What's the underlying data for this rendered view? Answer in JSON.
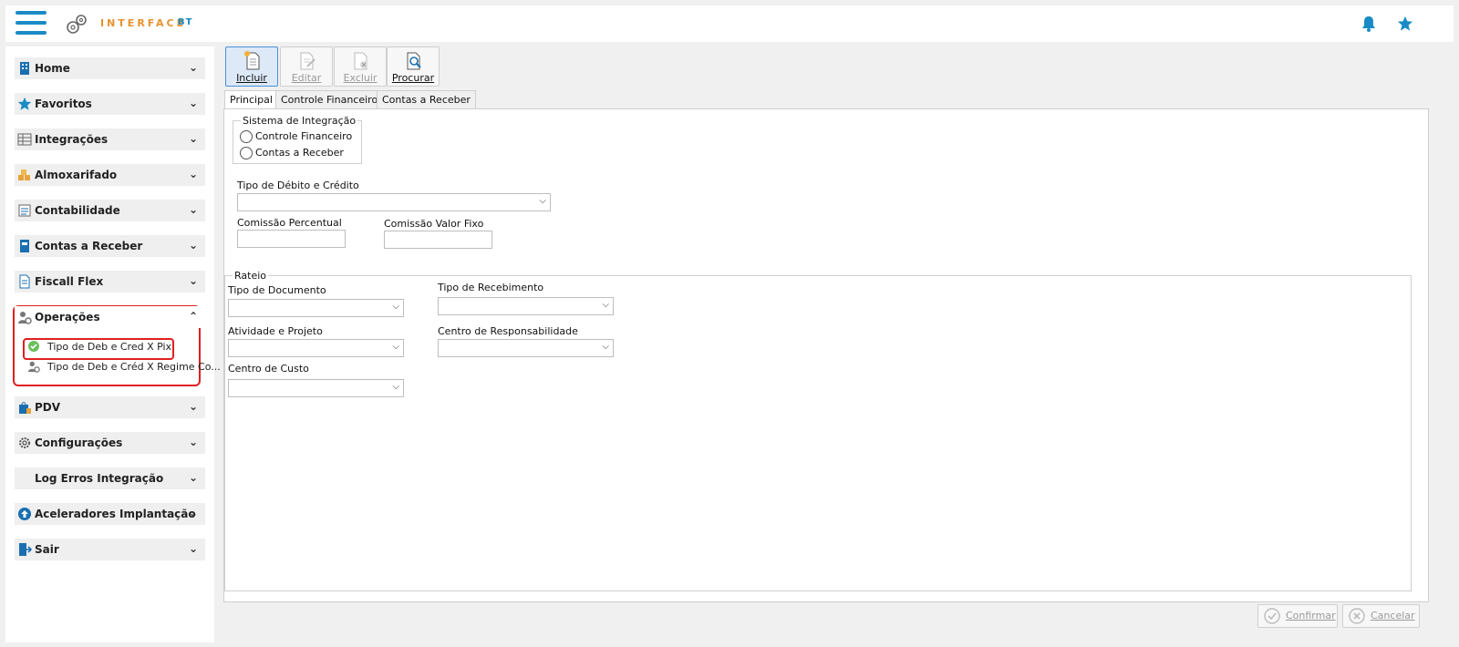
{
  "header": {
    "brand": "INTERFACE",
    "brand_suffix": "BT",
    "icons": [
      "menu-icon",
      "gear-logo-icon",
      "bell-icon",
      "star-icon"
    ],
    "accent": "#1a8bc4",
    "brand_color": "#e8922e"
  },
  "sidebar": {
    "items": [
      {
        "label": "Home",
        "icon": "building-icon"
      },
      {
        "label": "Favoritos",
        "icon": "star-icon"
      },
      {
        "label": "Integrações",
        "icon": "table-icon"
      },
      {
        "label": "Almoxarifado",
        "icon": "boxes-icon"
      },
      {
        "label": "Contabilidade",
        "icon": "ledger-icon"
      },
      {
        "label": "Contas a Receber",
        "icon": "book-icon"
      },
      {
        "label": "Fiscall Flex",
        "icon": "document-icon"
      },
      {
        "label": "Operações",
        "icon": "user-gear-icon"
      },
      {
        "label": "PDV",
        "icon": "bag-icon"
      },
      {
        "label": "Configurações",
        "icon": "gear-icon"
      },
      {
        "label": "Log Erros Integração",
        "icon": "log-icon"
      },
      {
        "label": "Aceleradores Implantação",
        "icon": "arrow-up-icon"
      },
      {
        "label": "Sair",
        "icon": "exit-icon"
      }
    ],
    "sub_items": [
      {
        "label": "Tipo de Deb e Cred X Pix",
        "icon": "check-icon"
      },
      {
        "label": "Tipo de Deb e Créd X Regime Co...",
        "icon": "user-gear-icon"
      }
    ]
  },
  "toolbar": {
    "incluir": "Incluir",
    "editar": "Editar",
    "excluir": "Excluir",
    "procurar": "Procurar"
  },
  "tabs": [
    "Principal",
    "Controle Financeiro",
    "Contas a Receber"
  ],
  "form": {
    "sistema_integracao": {
      "title": "Sistema de Integração",
      "options": [
        "Controle Financeiro",
        "Contas a Receber"
      ]
    },
    "tipo_debito_credito": "Tipo de Débito e Crédito",
    "comissao_percentual": "Comissão Percentual",
    "comissao_valor_fixo": "Comissão Valor Fixo",
    "rateio": {
      "title": "Rateio",
      "tipo_documento": "Tipo de Documento",
      "tipo_recebimento": "Tipo de Recebimento",
      "atividade_projeto": "Atividade e Projeto",
      "centro_responsabilidade": "Centro de Responsabilidade",
      "centro_custo": "Centro de Custo"
    }
  },
  "footer": {
    "confirmar": "Confirmar",
    "cancelar": "Cancelar"
  }
}
